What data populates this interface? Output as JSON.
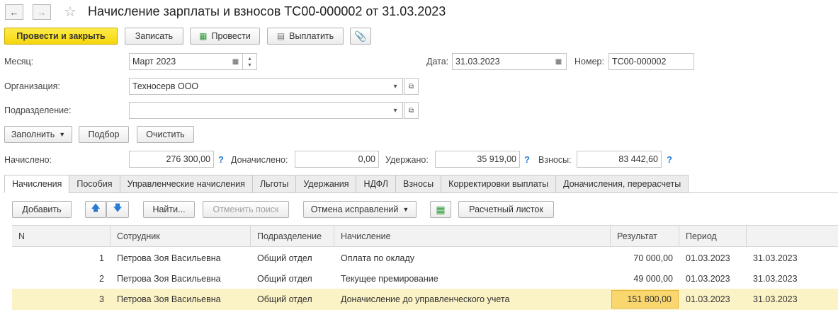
{
  "window": {
    "title": "Начисление зарплаты и взносов ТС00-000002 от 31.03.2023"
  },
  "icons": {
    "back": "arrow-left-icon",
    "forward": "arrow-right-icon",
    "favorite": "star-icon",
    "attach": "paperclip-icon",
    "calendar": "calendar-icon",
    "open": "open-link-icon",
    "help": "help-question-icon",
    "up": "arrow-up-icon",
    "down": "arrow-down-icon"
  },
  "toolbar": {
    "post_close": "Провести и закрыть",
    "write": "Записать",
    "post": "Провести",
    "pay": "Выплатить"
  },
  "fields": {
    "month_label": "Месяц:",
    "month_value": "Март 2023",
    "date_label": "Дата:",
    "date_value": "31.03.2023",
    "number_label": "Номер:",
    "number_value": "ТС00-000002",
    "org_label": "Организация:",
    "org_value": "Техносерв ООО",
    "dept_label": "Подразделение:",
    "dept_value": ""
  },
  "actions": {
    "fill": "Заполнить",
    "pick": "Подбор",
    "clear": "Очистить"
  },
  "totals": {
    "accrued_label": "Начислено:",
    "accrued_value": "276 300,00",
    "extra_label": "Доначислено:",
    "extra_value": "0,00",
    "withheld_label": "Удержано:",
    "withheld_value": "35 919,00",
    "contrib_label": "Взносы:",
    "contrib_value": "83 442,60",
    "help_mark": "?"
  },
  "tabs": [
    "Начисления",
    "Пособия",
    "Управленческие начисления",
    "Льготы",
    "Удержания",
    "НДФЛ",
    "Взносы",
    "Корректировки выплаты",
    "Доначисления, перерасчеты"
  ],
  "table_toolbar": {
    "add": "Добавить",
    "find": "Найти...",
    "cancel_search": "Отменить поиск",
    "cancel_fixes": "Отмена исправлений",
    "payslip": "Расчетный листок"
  },
  "table": {
    "columns": [
      "N",
      "Сотрудник",
      "Подразделение",
      "Начисление",
      "Результат",
      "Период",
      ""
    ],
    "rows": [
      {
        "n": "1",
        "employee": "Петрова Зоя Васильевна",
        "dept": "Общий отдел",
        "accrual": "Оплата по окладу",
        "result": "70 000,00",
        "from": "01.03.2023",
        "to": "31.03.2023"
      },
      {
        "n": "2",
        "employee": "Петрова Зоя Васильевна",
        "dept": "Общий отдел",
        "accrual": "Текущее премирование",
        "result": "49 000,00",
        "from": "01.03.2023",
        "to": "31.03.2023"
      },
      {
        "n": "3",
        "employee": "Петрова Зоя Васильевна",
        "dept": "Общий отдел",
        "accrual": "Доначисление до управленческого учета",
        "result": "151 800,00",
        "from": "01.03.2023",
        "to": "31.03.2023"
      }
    ],
    "selected_row": 3
  },
  "colors": {
    "primary_button": "#f5d60c",
    "selected_row": "#fbf2c5",
    "focused_cell": "#f9d66e",
    "help_mark": "#2b7bd6"
  }
}
